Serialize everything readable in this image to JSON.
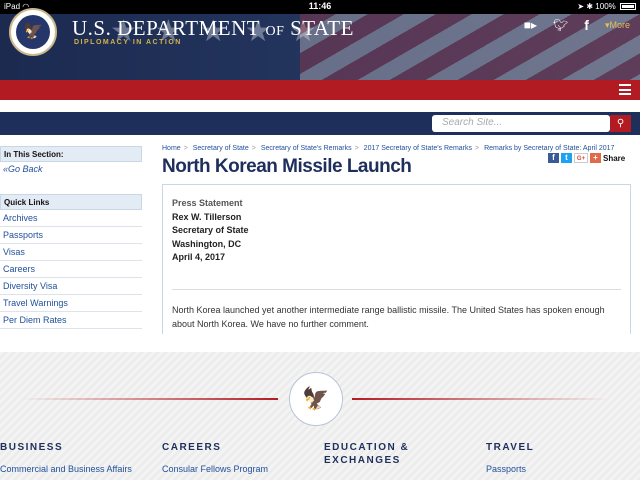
{
  "status_bar": {
    "device": "iPad",
    "time": "11:46",
    "battery": "100%"
  },
  "header": {
    "brand_main": "U.S. DEPARTMENT",
    "brand_of": "OF",
    "brand_end": "STATE",
    "tagline": "DIPLOMACY IN ACTION",
    "more_label": "More",
    "seal_glyph": "🦅"
  },
  "search": {
    "placeholder": "Search Site..."
  },
  "sidebar": {
    "in_this_section": "In This Section:",
    "go_back": "Go Back",
    "quick_links_title": "Quick Links",
    "quick_links": [
      "Archives",
      "Passports",
      "Visas",
      "Careers",
      "Diversity Visa",
      "Travel Warnings",
      "Per Diem Rates"
    ]
  },
  "breadcrumb": [
    "Home",
    "Secretary of State",
    "Secretary of State's Remarks",
    "2017 Secretary of State's Remarks",
    "Remarks by Secretary of State: April 2017"
  ],
  "article": {
    "title": "North Korean Missile Launch",
    "share_label": "Share",
    "type": "Press Statement",
    "author": "Rex W. Tillerson",
    "role": "Secretary of State",
    "location": "Washington, DC",
    "date": "April 4, 2017",
    "body": "North Korea launched yet another intermediate range ballistic missile. The United States has spoken enough about North Korea. We have no further comment."
  },
  "footer": {
    "columns": [
      {
        "heading": "BUSINESS",
        "link": "Commercial and Business Affairs"
      },
      {
        "heading": "CAREERS",
        "link": "Consular Fellows Program"
      },
      {
        "heading": "EDUCATION &\nEXCHANGES",
        "link": ""
      },
      {
        "heading": "TRAVEL",
        "link": "Passports"
      }
    ]
  },
  "colors": {
    "navy": "#1e2f5c",
    "red": "#b31b23",
    "gold": "#d6b44a",
    "link": "#1f4f99"
  }
}
